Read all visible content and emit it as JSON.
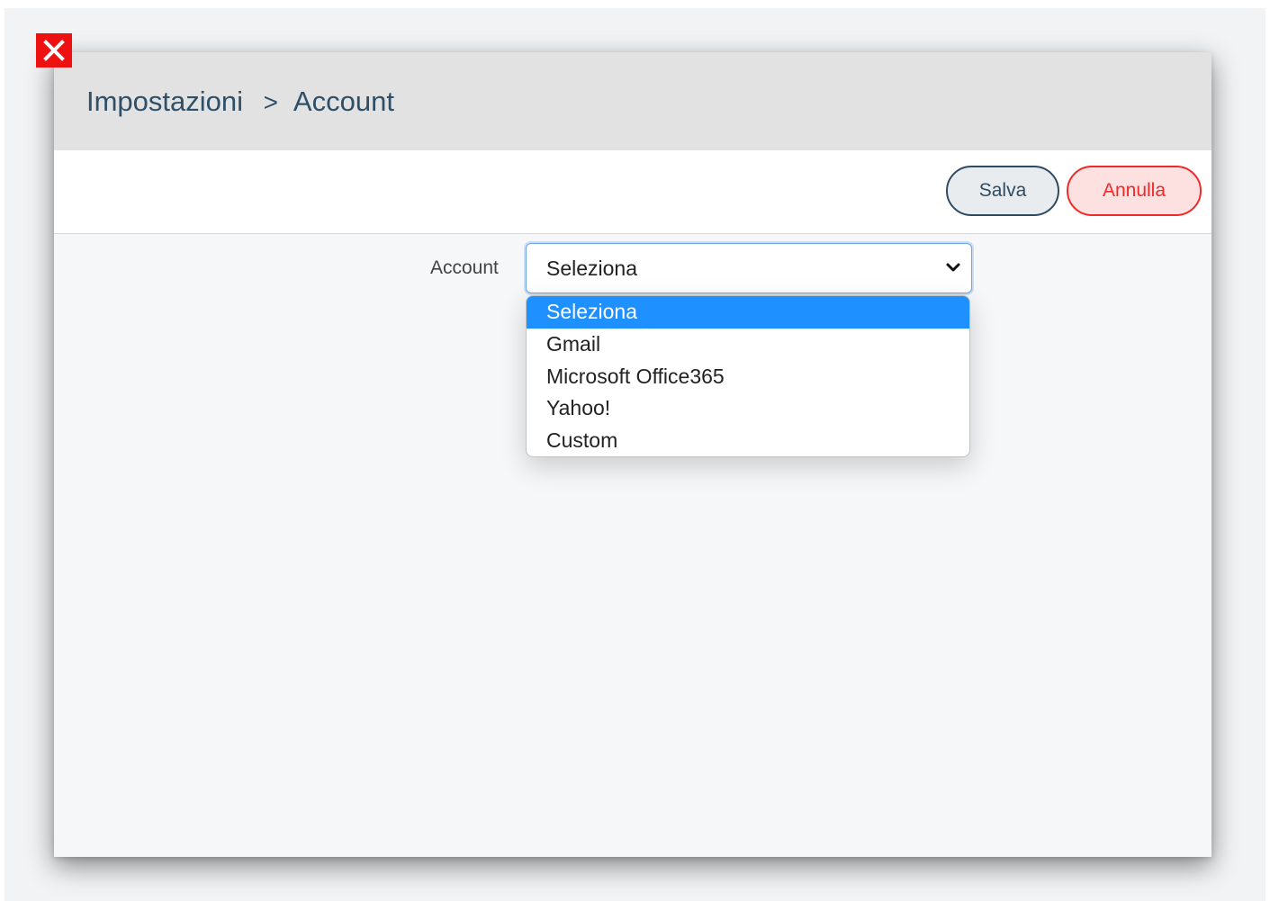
{
  "dialog": {
    "close_icon": "close-icon",
    "breadcrumb": {
      "parent": "Impostazioni",
      "separator": ">",
      "current": "Account"
    }
  },
  "toolbar": {
    "save_label": "Salva",
    "cancel_label": "Annulla"
  },
  "form": {
    "account_label": "Account",
    "account_select": {
      "value": "Seleziona",
      "options": [
        {
          "label": "Seleziona",
          "selected": true
        },
        {
          "label": "Gmail",
          "selected": false
        },
        {
          "label": "Microsoft Office365",
          "selected": false
        },
        {
          "label": "Yahoo!",
          "selected": false
        },
        {
          "label": "Custom",
          "selected": false
        }
      ]
    }
  },
  "colors": {
    "close_red": "#ee1111",
    "save_border": "#2e4b63",
    "cancel_red": "#ef2a2a",
    "option_highlight": "#1e90ff"
  }
}
